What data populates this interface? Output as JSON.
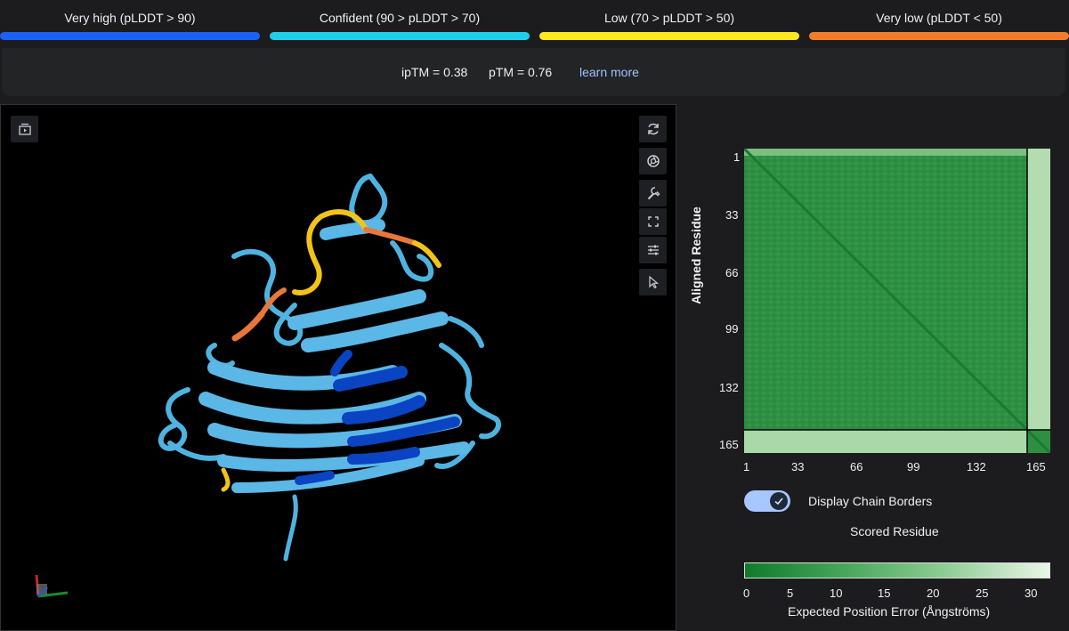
{
  "legend": [
    {
      "label": "Very high (pLDDT > 90)",
      "color": "#1a61f5"
    },
    {
      "label": "Confident (90 > pLDDT > 70)",
      "color": "#1ecfe9"
    },
    {
      "label": "Low (70 > pLDDT > 50)",
      "color": "#ffe81f"
    },
    {
      "label": "Very low (pLDDT < 50)",
      "color": "#f07d2c"
    }
  ],
  "metrics": {
    "iptm": "ipTM = 0.38",
    "ptm": "pTM = 0.76",
    "learn_more": "learn more"
  },
  "viewer": {
    "toolbar_icons": [
      "refresh-icon",
      "camera-icon",
      "wrench-icon",
      "fullscreen-icon",
      "sliders-icon",
      "pointer-icon"
    ],
    "top_left_icon": "playback-icon"
  },
  "pae": {
    "y_title": "Aligned Residue",
    "x_title": "Scored Residue",
    "ticks": [
      "1",
      "33",
      "66",
      "99",
      "132",
      "165"
    ],
    "chain_border_residue": 150,
    "max_residue": 165,
    "toggle_label": "Display Chain Borders",
    "toggle_on": true
  },
  "colorbar": {
    "ticks": [
      "0",
      "5",
      "10",
      "15",
      "20",
      "25",
      "30"
    ],
    "title": "Expected Position Error (Ångströms)",
    "colors": [
      "#0f7a2d",
      "#e9f6e7"
    ]
  }
}
